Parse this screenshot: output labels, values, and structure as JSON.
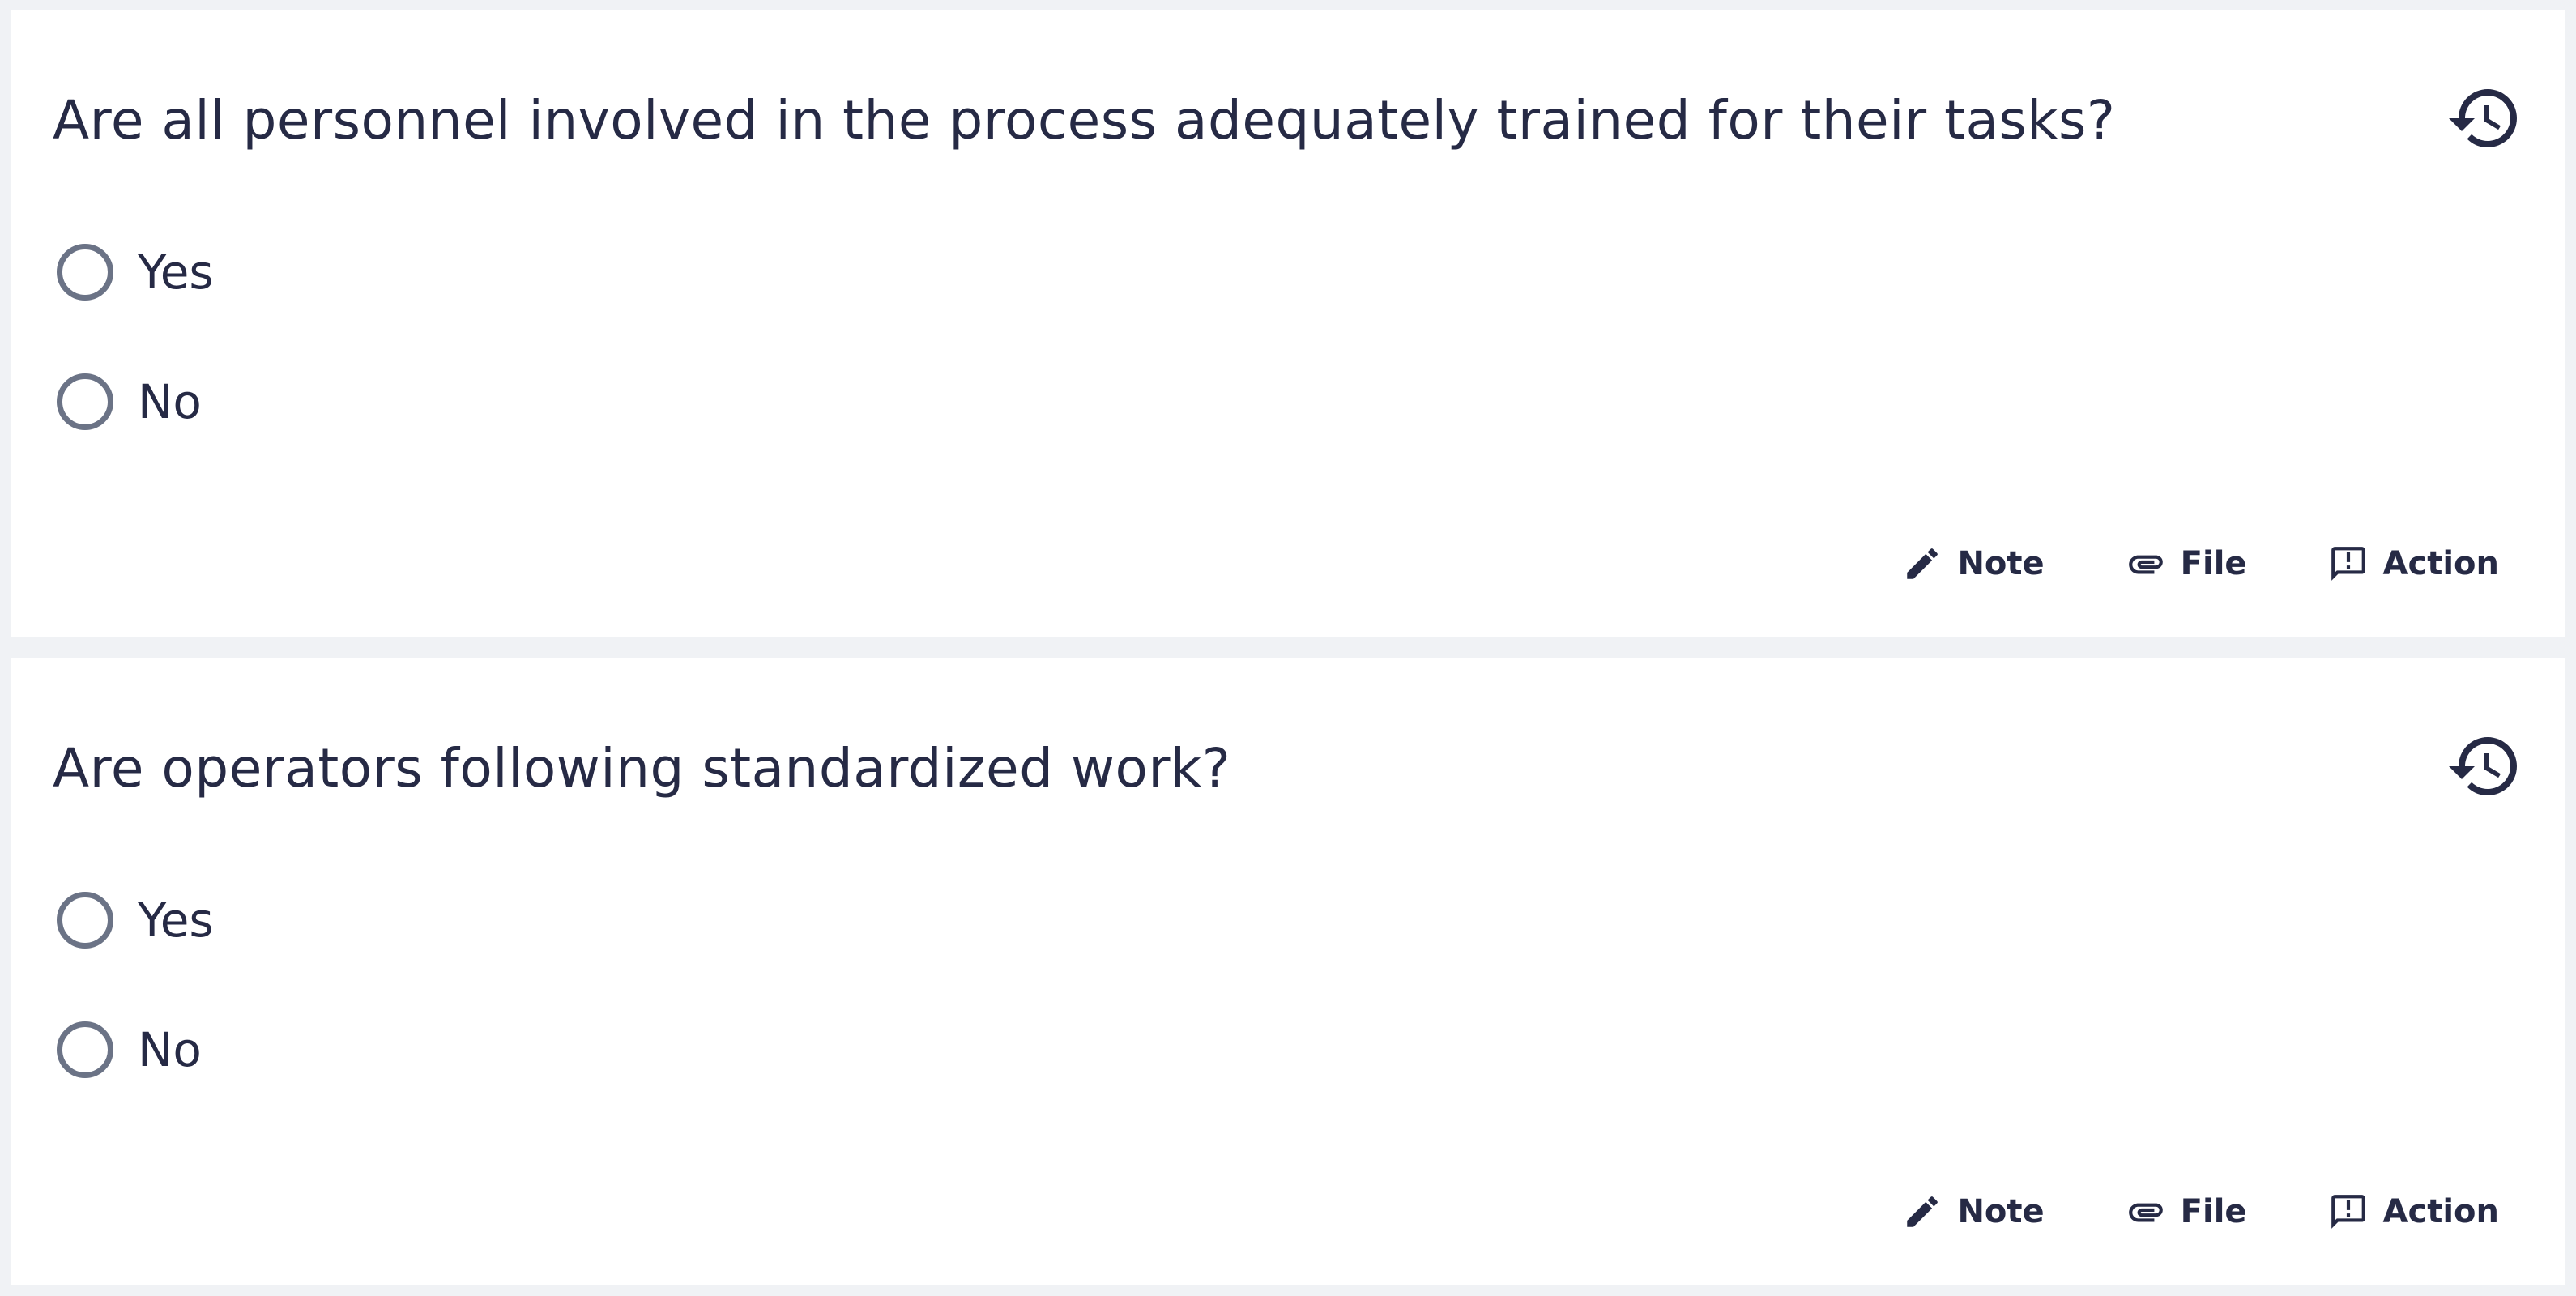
{
  "questions": [
    {
      "title": "Are all personnel involved in the process adequately trained for their tasks?",
      "options": [
        "Yes",
        "No"
      ],
      "actions": {
        "note": "Note",
        "file": "File",
        "action": "Action"
      }
    },
    {
      "title": "Are operators following standardized work?",
      "options": [
        "Yes",
        "No"
      ],
      "actions": {
        "note": "Note",
        "file": "File",
        "action": "Action"
      }
    }
  ],
  "icons": {
    "history": "history-icon",
    "note": "pencil-icon",
    "file": "paperclip-icon",
    "action": "report-icon"
  },
  "colors": {
    "background": "#f0f2f5",
    "card": "#ffffff",
    "text": "#262a45",
    "radio_border": "#6b7386"
  }
}
